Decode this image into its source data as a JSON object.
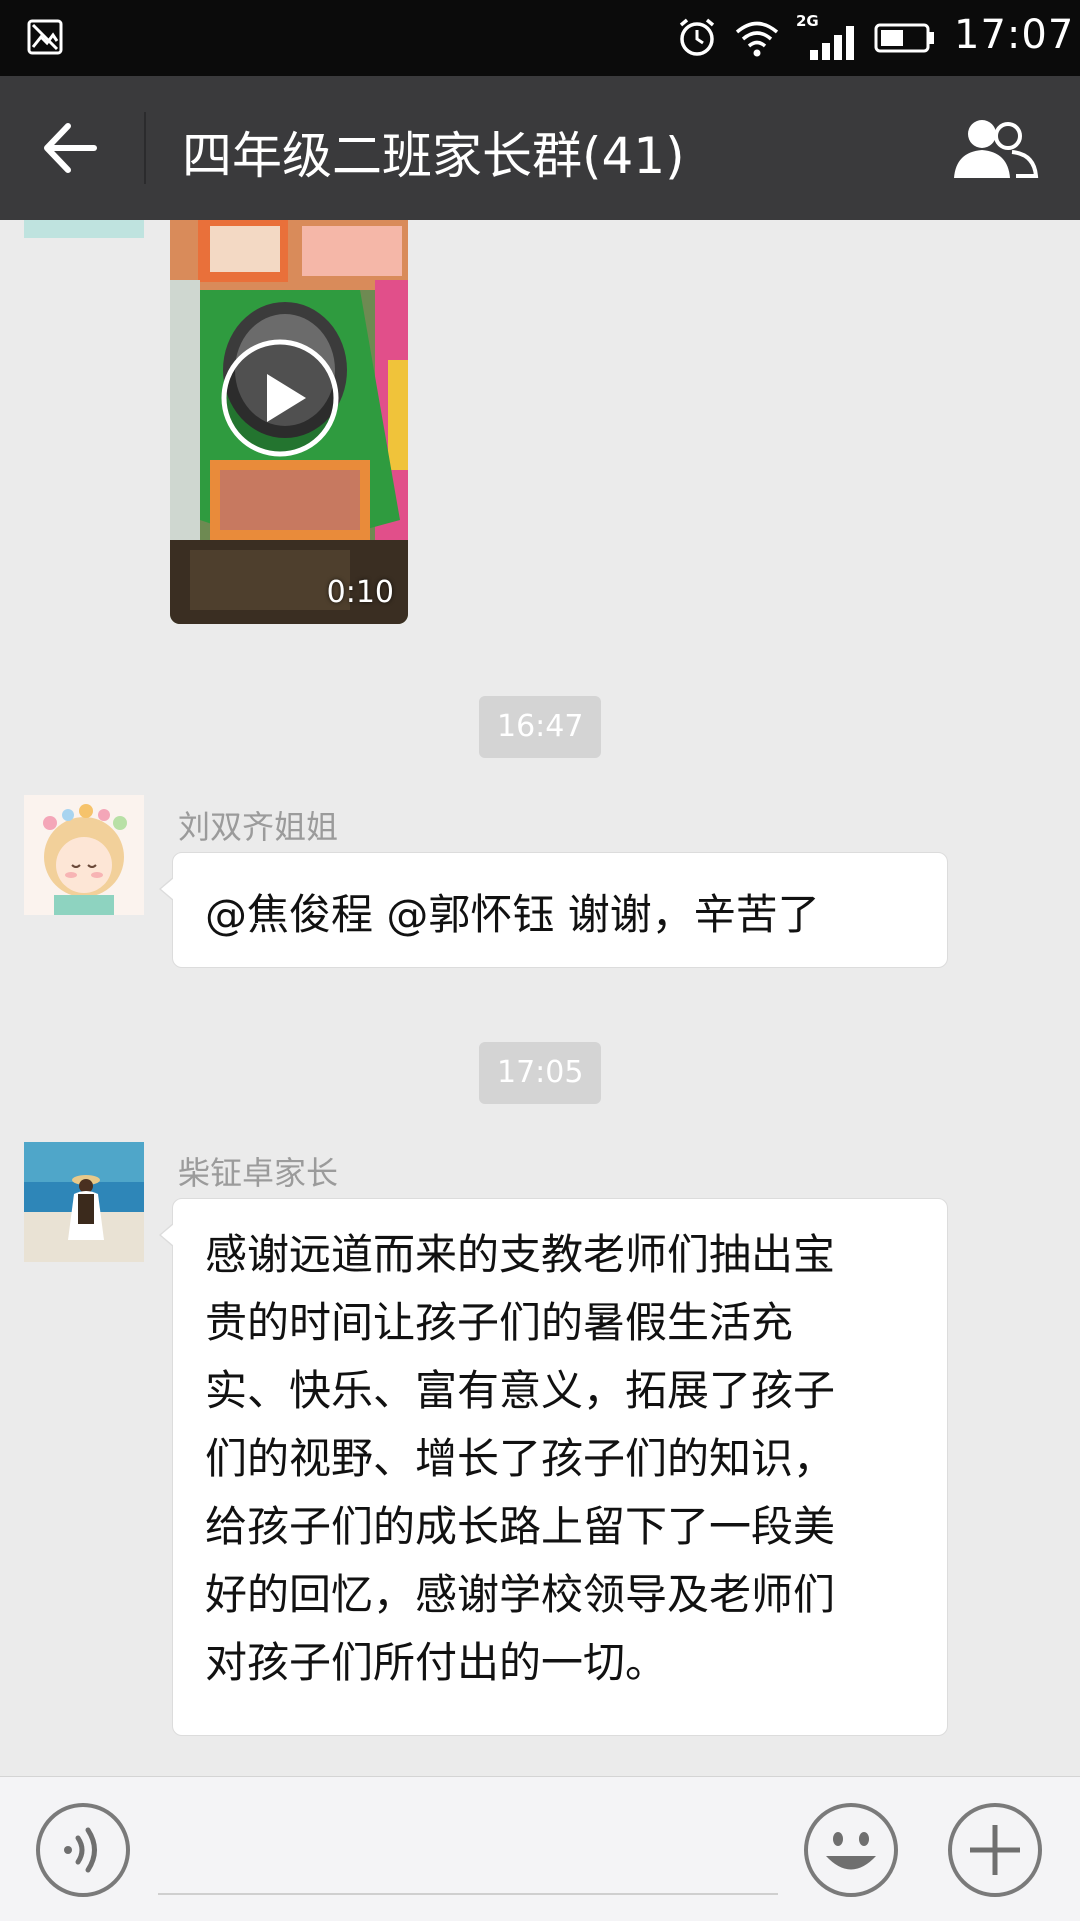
{
  "status_bar": {
    "network_type": "2G",
    "time": "17:07",
    "icons": [
      "gallery-icon",
      "alarm-icon",
      "wifi-icon",
      "signal-icon",
      "battery-icon"
    ]
  },
  "nav": {
    "title": "四年级二班家长群(41)",
    "back_icon": "arrow-left-icon",
    "members_icon": "group-members-icon"
  },
  "messages": {
    "video": {
      "duration": "0:10"
    },
    "timestamp_1": "16:47",
    "msg_1": {
      "sender": "刘双齐姐姐",
      "text": "@焦俊程 @郭怀钰 谢谢，辛苦了"
    },
    "timestamp_2": "17:05",
    "msg_2": {
      "sender": "柴钲卓家长",
      "lines": [
        "感谢远道而来的支教老师们抽出宝",
        "贵的时间让孩子们的暑假生活充",
        "实、快乐、富有意义，拓展了孩子",
        "们的视野、增长了孩子们的知识，",
        "给孩子们的成长路上留下了一段美",
        "好的回忆，感谢学校领导及老师们",
        "对孩子们所付出的一切。"
      ]
    }
  },
  "input_bar": {
    "icons": [
      "voice-icon",
      "emoji-icon",
      "plus-icon"
    ]
  }
}
